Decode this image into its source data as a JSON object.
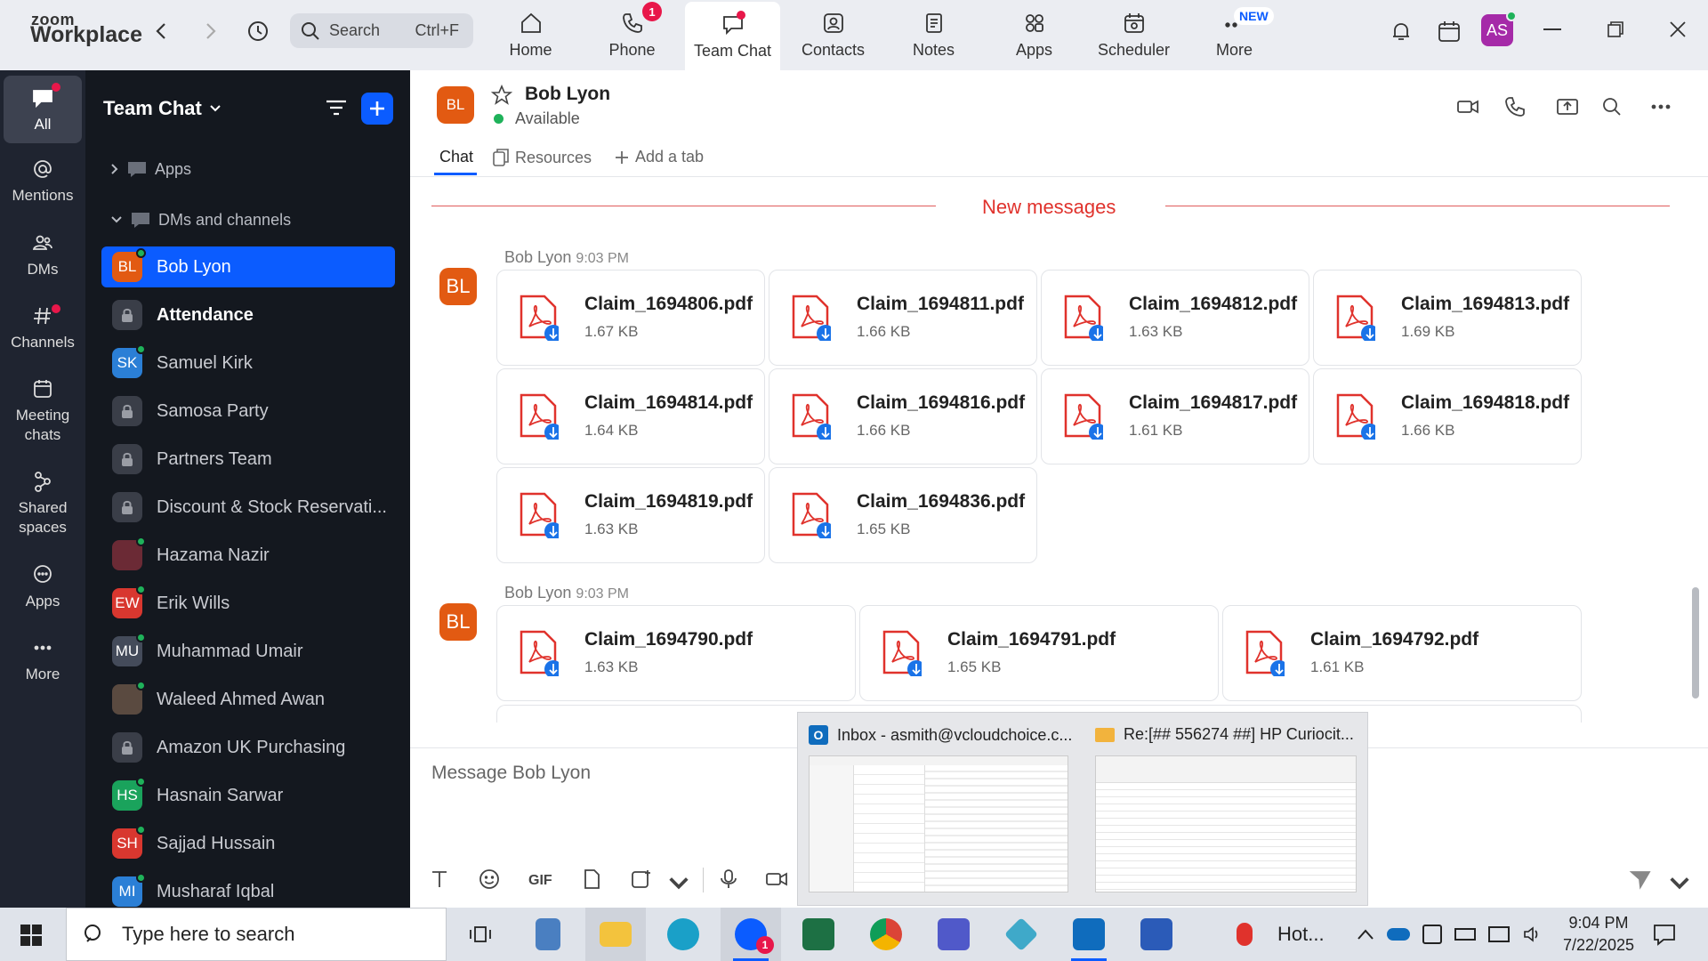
{
  "app": {
    "logo_top": "zoom",
    "logo_bottom": "Workplace"
  },
  "topbar": {
    "search_placeholder": "Search",
    "search_shortcut": "Ctrl+F",
    "nav": [
      {
        "label": "Home",
        "icon": "home-icon"
      },
      {
        "label": "Phone",
        "icon": "phone-icon",
        "badge": "1"
      },
      {
        "label": "Team Chat",
        "icon": "chat-icon",
        "active": true
      },
      {
        "label": "Contacts",
        "icon": "contacts-icon"
      },
      {
        "label": "Notes",
        "icon": "notes-icon"
      },
      {
        "label": "Apps",
        "icon": "apps-icon"
      },
      {
        "label": "Scheduler",
        "icon": "scheduler-icon"
      },
      {
        "label": "More",
        "icon": "more-icon",
        "tag": "NEW"
      }
    ],
    "avatar_initials": "AS"
  },
  "rail": [
    {
      "label": "All",
      "icon": "chat-bubble-icon",
      "active": true
    },
    {
      "label": "Mentions",
      "icon": "at-icon"
    },
    {
      "label": "DMs",
      "icon": "people-icon"
    },
    {
      "label": "Channels",
      "icon": "hash-icon"
    },
    {
      "label": "Meeting chats",
      "icon": "calendar-icon"
    },
    {
      "label": "Shared spaces",
      "icon": "share-icon"
    },
    {
      "label": "Apps",
      "icon": "apps-bubble-icon"
    },
    {
      "label": "More",
      "icon": "ellipsis-icon"
    }
  ],
  "sidebar": {
    "title": "Team Chat",
    "section_apps": "Apps",
    "section_dms": "DMs and channels",
    "channels": [
      {
        "name": "Bob Lyon",
        "initials": "BL",
        "color": "#e25a12",
        "selected": true
      },
      {
        "name": "Attendance",
        "lock": true,
        "bold": true
      },
      {
        "name": "Samuel Kirk",
        "initials": "SK",
        "color": "#2b7fd6"
      },
      {
        "name": "Samosa Party",
        "lock": true
      },
      {
        "name": "Partners Team",
        "lock": true
      },
      {
        "name": "Discount & Stock Reservati...",
        "lock": true
      },
      {
        "name": "Hazama Nazir",
        "initials": "",
        "color": "#6b2a35"
      },
      {
        "name": "Erik Wills",
        "initials": "EW",
        "color": "#d8372f"
      },
      {
        "name": "Muhammad Umair",
        "initials": "MU",
        "color": "#444b5a"
      },
      {
        "name": "Waleed Ahmed Awan",
        "initials": "",
        "color": "#5a4a40"
      },
      {
        "name": "Amazon UK Purchasing",
        "lock": true
      },
      {
        "name": "Hasnain Sarwar",
        "initials": "HS",
        "color": "#1aa35c"
      },
      {
        "name": "Sajjad Hussain",
        "initials": "SH",
        "color": "#d8372f"
      },
      {
        "name": "Musharaf Iqbal",
        "initials": "MI",
        "color": "#2b7fd6"
      }
    ]
  },
  "chat": {
    "contact_name": "Bob Lyon",
    "contact_initials": "BL",
    "status": "Available",
    "tabs": [
      "Chat",
      "Resources",
      "Add a tab"
    ],
    "new_messages_label": "New messages",
    "groups": [
      {
        "sender": "Bob Lyon",
        "time": "9:03 PM",
        "files": [
          {
            "name": "Claim_1694806.pdf",
            "size": "1.67 KB"
          },
          {
            "name": "Claim_1694811.pdf",
            "size": "1.66 KB"
          },
          {
            "name": "Claim_1694812.pdf",
            "size": "1.63 KB"
          },
          {
            "name": "Claim_1694813.pdf",
            "size": "1.69 KB"
          },
          {
            "name": "Claim_1694814.pdf",
            "size": "1.64 KB"
          },
          {
            "name": "Claim_1694816.pdf",
            "size": "1.66 KB"
          },
          {
            "name": "Claim_1694817.pdf",
            "size": "1.61 KB"
          },
          {
            "name": "Claim_1694818.pdf",
            "size": "1.66 KB"
          },
          {
            "name": "Claim_1694819.pdf",
            "size": "1.63 KB"
          },
          {
            "name": "Claim_1694836.pdf",
            "size": "1.65 KB"
          }
        ]
      },
      {
        "sender": "Bob Lyon",
        "time": "9:03 PM",
        "files": [
          {
            "name": "Claim_1694790.pdf",
            "size": "1.63 KB"
          },
          {
            "name": "Claim_1694791.pdf",
            "size": "1.65 KB"
          },
          {
            "name": "Claim_1694792.pdf",
            "size": "1.61 KB"
          }
        ]
      }
    ],
    "composer_placeholder": "Message Bob Lyon",
    "gif_label": "GIF"
  },
  "popup": {
    "windows": [
      {
        "title": "Inbox - asmith@vcloudchoice.c...",
        "icon": "outlook-icon"
      },
      {
        "title": "Re:[## 556274 ##] HP Curiocit...",
        "icon": "mail-envelope-icon"
      }
    ]
  },
  "taskbar": {
    "search_placeholder": "Type here to search",
    "weather": "Hot...",
    "time": "9:04 PM",
    "date": "7/22/2025",
    "zoom_badge": "1"
  },
  "colors": {
    "accent": "#0b5cff",
    "pdf_red": "#e0322c",
    "alert": "#e8174a",
    "presence": "#1fb25a"
  }
}
